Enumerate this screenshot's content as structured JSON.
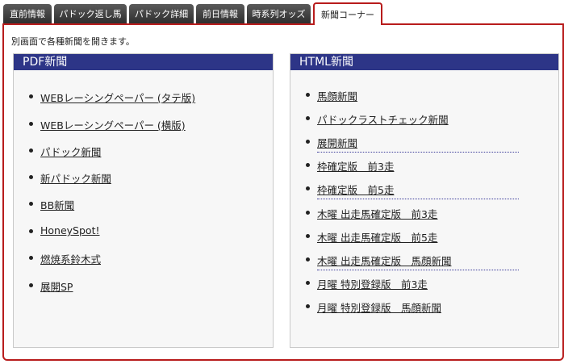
{
  "tabs": [
    {
      "label": "直前情報",
      "active": false
    },
    {
      "label": "パドック返し馬",
      "active": false
    },
    {
      "label": "パドック詳細",
      "active": false
    },
    {
      "label": "前日情報",
      "active": false
    },
    {
      "label": "時系列オッズ",
      "active": false
    },
    {
      "label": "新聞コーナー",
      "active": true
    }
  ],
  "intro": "別画面で各種新聞を開きます。",
  "pdf": {
    "title": "PDF新聞",
    "items": [
      "WEBレーシングペーパー (タテ版)",
      "WEBレーシングペーパー (横版)",
      "パドック新聞",
      "新パドック新聞",
      "BB新聞",
      "HoneySpot!",
      "燃焼系鈴木式",
      "展開SP"
    ]
  },
  "html": {
    "title": "HTML新聞",
    "items": [
      "馬顔新聞",
      "パドックラストチェック新聞",
      "展開新聞",
      "枠確定版　前3走",
      "枠確定版　前5走",
      "木曜 出走馬確定版　前3走",
      "木曜 出走馬確定版　前5走",
      "木曜 出走馬確定版　馬顔新聞",
      "月曜 特別登録版　前3走",
      "月曜 特別登録版　馬顔新聞"
    ]
  },
  "colors": {
    "panel_header": "#2d3587",
    "tab_active_border": "#b81c1c",
    "tab_inactive": "#3c3c3c",
    "separator": "#3a3a9a"
  }
}
